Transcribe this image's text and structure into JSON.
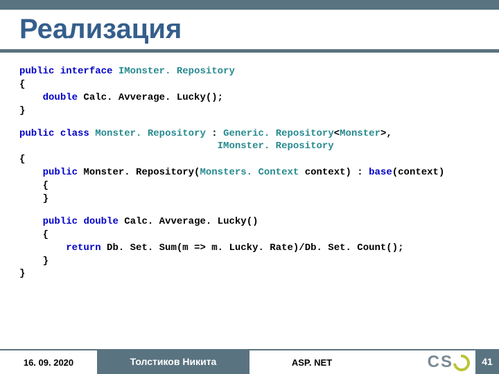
{
  "title": "Реализация",
  "code": {
    "l01a": "public",
    "l01b": " ",
    "l01c": "interface",
    "l01d": " ",
    "l01e": "IMonster. Repository",
    "l02": "{",
    "l03a": "    ",
    "l03b": "double",
    "l03c": " Calc. Avverage. Lucky();",
    "l04": "}",
    "l05a": "public",
    "l05b": " ",
    "l05c": "class",
    "l05d": " ",
    "l05e": "Monster. Repository",
    "l05f": " : ",
    "l05g": "Generic. Repository",
    "l05h": "<",
    "l05i": "Monster",
    "l05j": ">,",
    "l06a": "                                  ",
    "l06b": "IMonster. Repository",
    "l07": "{",
    "l08a": "    ",
    "l08b": "public",
    "l08c": " Monster. Repository(",
    "l08d": "Monsters. Context",
    "l08e": " context) : ",
    "l08f": "base",
    "l08g": "(context)",
    "l09": "    {",
    "l10": "    }",
    "l11a": "    ",
    "l11b": "public",
    "l11c": " ",
    "l11d": "double",
    "l11e": " Calc. Avverage. Lucky()",
    "l12": "    {",
    "l13a": "        ",
    "l13b": "return",
    "l13c": " Db. Set. Sum(m => m. Lucky. Rate)/Db. Set. Count();",
    "l14": "    }",
    "l15": "}"
  },
  "footer": {
    "date": "16. 09. 2020",
    "author": "Толстиков Никита",
    "subject": "ASP. NET",
    "page": "41",
    "logo_text": "CSC"
  }
}
